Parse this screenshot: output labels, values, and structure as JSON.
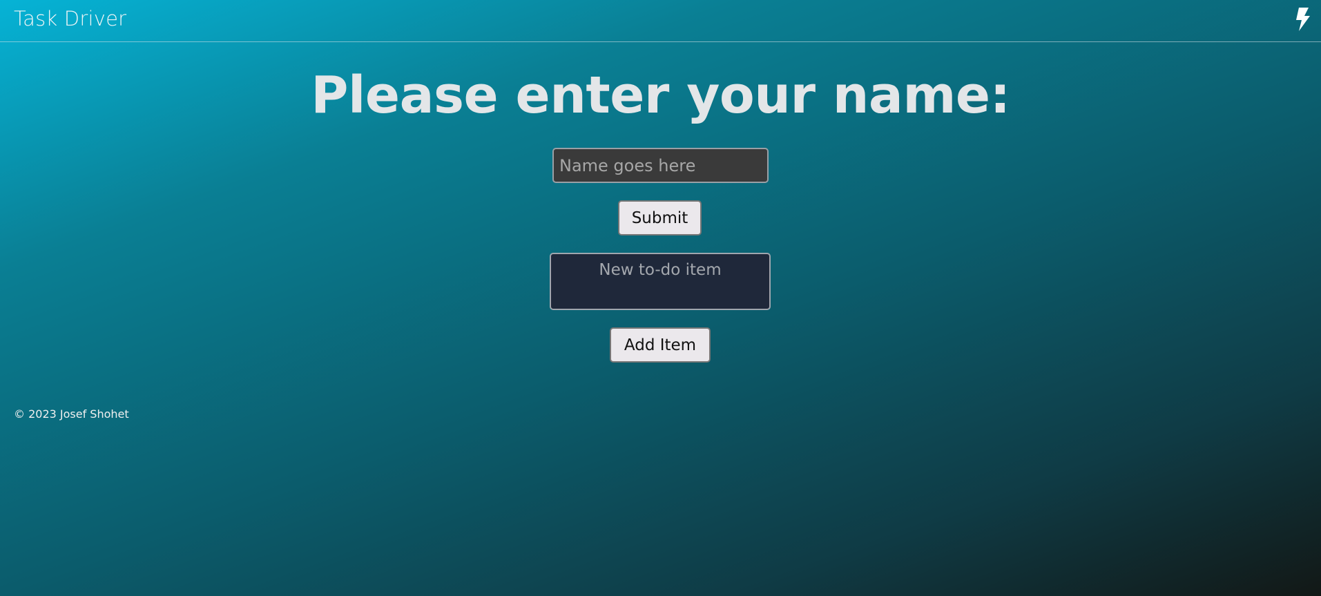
{
  "navbar": {
    "brand": "Task Driver",
    "icon": "lightning-bolt-icon"
  },
  "main": {
    "heading": "Please enter your name:",
    "name_input": {
      "placeholder": "Name goes here",
      "value": ""
    },
    "submit_label": "Submit",
    "todo_input": {
      "placeholder": "New to-do item",
      "value": ""
    },
    "add_item_label": "Add Item"
  },
  "footer": {
    "copyright": "© 2023 Josef Shohet"
  },
  "colors": {
    "gradient_start": "#06b3d6",
    "gradient_end": "#121816",
    "name_input_bg": "#3a3a3a",
    "todo_input_bg": "#1f283a",
    "button_bg": "#ebe8ec"
  }
}
